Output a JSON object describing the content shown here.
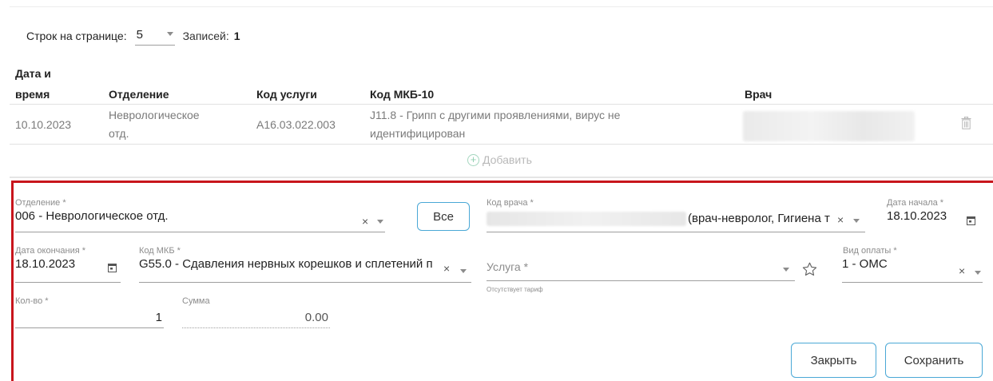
{
  "pager": {
    "rows_label": "Строк на странице:",
    "rows_value": "5",
    "records_label": "Записей:",
    "records_count": "1"
  },
  "table": {
    "headers": {
      "datetime_line1": "Дата и",
      "datetime_line2": "время",
      "department": "Отделение",
      "service_code": "Код услуги",
      "icd10": "Код МКБ-10",
      "doctor": "Врач"
    },
    "rows": [
      {
        "date": "10.10.2023",
        "department_line1": "Неврологическое",
        "department_line2": "отд.",
        "service_code": "A16.03.022.003",
        "icd_line1": "J11.8 - Грипп с другими проявлениями, вирус не",
        "icd_line2": "идентифицирован",
        "doctor": ""
      }
    ],
    "add_label": "Добавить"
  },
  "form": {
    "department": {
      "label": "Отделение *",
      "value": "006 - Неврологическое отд."
    },
    "all_button": "Все",
    "doctor_code": {
      "label": "Код врача *",
      "value_suffix": "(врач-невролог, Гигиена т"
    },
    "start_date": {
      "label": "Дата начала *",
      "value": "18.10.2023"
    },
    "end_date": {
      "label": "Дата окончания *",
      "value": "18.10.2023"
    },
    "icd": {
      "label": "Код МКБ *",
      "value": "G55.0 - Сдавления нервных корешков и сплетений п"
    },
    "service": {
      "placeholder": "Услуга *",
      "hint": "Отсутствует тариф"
    },
    "payment": {
      "label": "Вид оплаты *",
      "value": "1 - ОМС"
    },
    "qty": {
      "label": "Кол-во *",
      "value": "1"
    },
    "sum": {
      "label": "Сумма",
      "value": "0.00"
    },
    "close_button": "Закрыть",
    "save_button": "Сохранить"
  },
  "icons": [
    "chevron-down-icon",
    "trash-icon",
    "plus-circle-icon",
    "clear-icon",
    "calendar-icon",
    "star-icon"
  ],
  "colors": {
    "accent_border": "#4aa8d6",
    "panel_border": "#c8151c",
    "add_icon": "#8fd0b0"
  }
}
